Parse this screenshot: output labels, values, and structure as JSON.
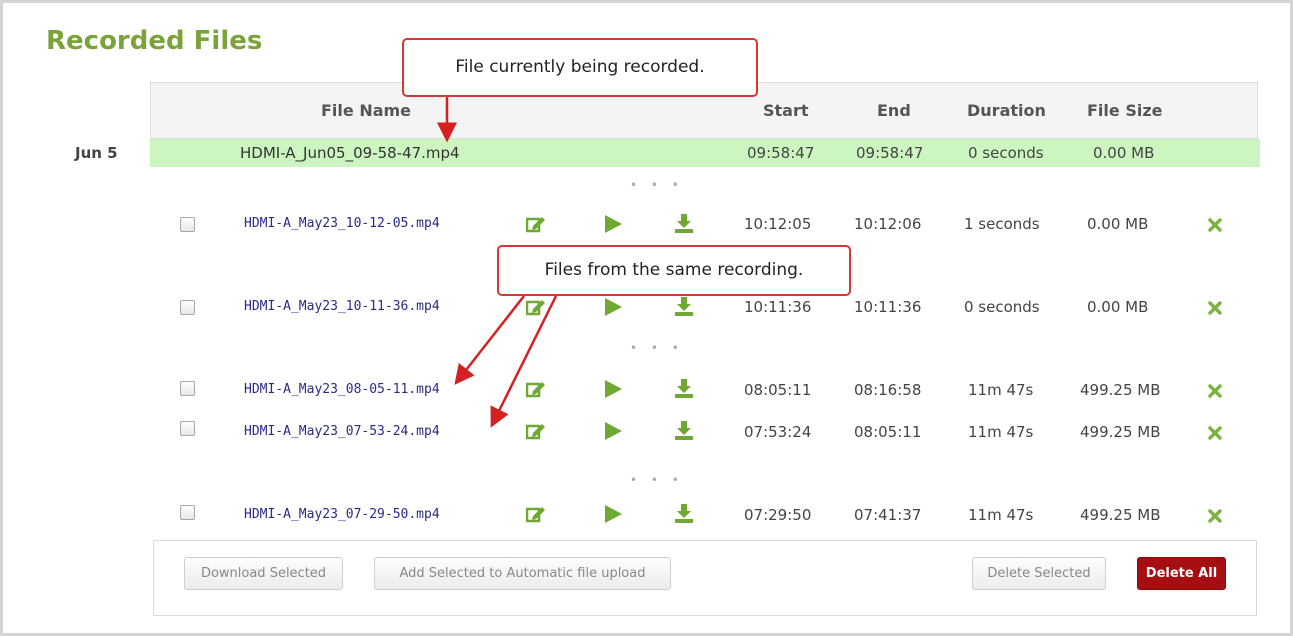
{
  "page": {
    "title": "Recorded Files"
  },
  "table": {
    "headers": {
      "file_name": "File Name",
      "start": "Start",
      "end": "End",
      "duration": "Duration",
      "file_size": "File Size"
    },
    "current": {
      "date": "Jun 5",
      "file": "HDMI-A_Jun05_09-58-47.mp4",
      "start": "09:58:47",
      "end": "09:58:47",
      "duration": "0 seconds",
      "size": "0.00 MB"
    },
    "rows": [
      {
        "file": "HDMI-A_May23_10-12-05.mp4",
        "start": "10:12:05",
        "end": "10:12:06",
        "duration": "1 seconds",
        "size": "0.00 MB"
      },
      {
        "file": "HDMI-A_May23_10-11-36.mp4",
        "start": "10:11:36",
        "end": "10:11:36",
        "duration": "0 seconds",
        "size": "0.00 MB"
      },
      {
        "file": "HDMI-A_May23_08-05-11.mp4",
        "start": "08:05:11",
        "end": "08:16:58",
        "duration": "11m 47s",
        "size": "499.25 MB"
      },
      {
        "file": "HDMI-A_May23_07-53-24.mp4",
        "start": "07:53:24",
        "end": "08:05:11",
        "duration": "11m 47s",
        "size": "499.25 MB"
      },
      {
        "file": "HDMI-A_May23_07-29-50.mp4",
        "start": "07:29:50",
        "end": "07:41:37",
        "duration": "11m 47s",
        "size": "499.25 MB"
      }
    ],
    "ellipsis": "• • •"
  },
  "buttons": {
    "download_selected": "Download Selected",
    "add_to_upload": "Add Selected to Automatic file upload",
    "delete_selected": "Delete Selected",
    "delete_all": "Delete All"
  },
  "callouts": {
    "current": "File currently being recorded.",
    "same_recording": "Files from the same recording."
  },
  "icons": {
    "edit": "edit-icon",
    "play": "play-icon",
    "download": "download-icon",
    "delete": "delete-icon",
    "checkbox": "checkbox"
  },
  "colors": {
    "accent_green": "#7ba33b",
    "current_row": "#ccf5c0",
    "danger": "#a60e12",
    "callout_border": "#d23b35"
  }
}
